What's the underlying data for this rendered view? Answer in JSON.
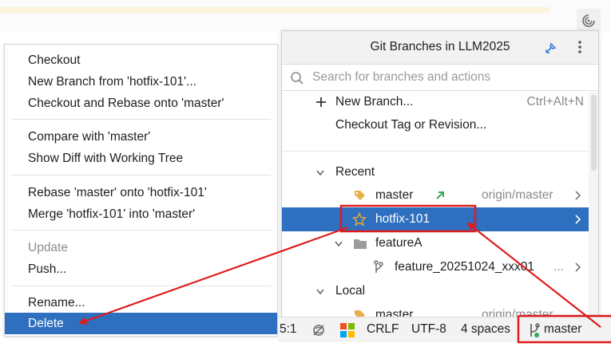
{
  "context_menu": {
    "items": [
      {
        "label": "Checkout"
      },
      {
        "label": "New Branch from 'hotfix-101'..."
      },
      {
        "label": "Checkout and Rebase onto 'master'"
      },
      {
        "label": "Compare with 'master'"
      },
      {
        "label": "Show Diff with Working Tree"
      },
      {
        "label": "Rebase 'master' onto 'hotfix-101'"
      },
      {
        "label": "Merge 'hotfix-101' into 'master'"
      },
      {
        "label": "Update",
        "disabled": true
      },
      {
        "label": "Push..."
      },
      {
        "label": "Rename..."
      },
      {
        "label": "Delete",
        "selected": true
      }
    ]
  },
  "git_popup": {
    "title": "Git Branches in LLM2025",
    "search_placeholder": "Search for branches and actions",
    "new_branch": {
      "label": "New Branch...",
      "shortcut": "Ctrl+Alt+N"
    },
    "checkout_tag": "Checkout Tag or Revision...",
    "recent_label": "Recent",
    "recent": [
      {
        "name": "master",
        "remote": "origin/master"
      },
      {
        "name": "hotfix-101",
        "selected": true
      }
    ],
    "group": {
      "name": "featureA",
      "child": "feature_20251024_xxx01",
      "child_suffix": "..."
    },
    "local_label": "Local",
    "local_partial": {
      "name": "master",
      "remote": "origin/master"
    }
  },
  "status_bar": {
    "position": "5:1",
    "line_ending": "CRLF",
    "encoding": "UTF-8",
    "indent": "4 spaces",
    "branch": "master"
  },
  "colors": {
    "selection": "#2e6fbf",
    "annotation": "#e01b1b",
    "tag_icon": "#e8b04a",
    "star_icon": "#d99e2b",
    "folder_icon": "#8c8c8c",
    "arrow_green": "#3aa757"
  }
}
